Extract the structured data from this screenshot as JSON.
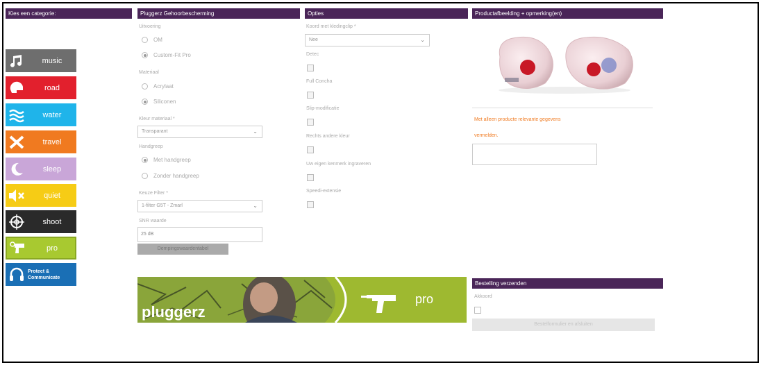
{
  "headers": {
    "category": "Kies een categorie:",
    "product": "Pluggerz Gehoorbescherming",
    "options": "Opties",
    "image": "Productafbeelding + opmerking(en)",
    "order": "Bestelling verzenden"
  },
  "categories": [
    {
      "label": "music",
      "icon": "music-note-icon",
      "color": "#6e6e6e"
    },
    {
      "label": "road",
      "icon": "helmet-icon",
      "color": "#e2202d"
    },
    {
      "label": "water",
      "icon": "wave-icon",
      "color": "#1fb4ea"
    },
    {
      "label": "travel",
      "icon": "airplane-icon",
      "color": "#f07a20"
    },
    {
      "label": "sleep",
      "icon": "moon-icon",
      "color": "#c9a6d8"
    },
    {
      "label": "quiet",
      "icon": "mute-speaker-icon",
      "color": "#f6cc15"
    },
    {
      "label": "shoot",
      "icon": "crosshair-icon",
      "color": "#2a2a2a"
    },
    {
      "label": "pro",
      "icon": "drill-icon",
      "color": "#a8c930"
    },
    {
      "label1": "Protect &",
      "label2": "Communicate",
      "icon": "headset-icon",
      "color": "#1a6fb5"
    }
  ],
  "product": {
    "uitvoering_label": "Uitvoering",
    "uitvoering_opts": [
      "OM",
      "Custom-Fit Pro"
    ],
    "materiaal_label": "Materiaal",
    "materiaal_opts": [
      "Acrylaat",
      "Siliconen"
    ],
    "kleur_label": "Kleur materiaal *",
    "kleur_value": "Transparant",
    "handgreep_label": "Handgreep",
    "handgreep_opts": [
      "Met handgreep",
      "Zonder handgreep"
    ],
    "filter_label": "Keuze Filter *",
    "filter_value": "1-filter G5T - Zmarl",
    "snr_label": "SNR waarde",
    "snr_value": "25 dB",
    "demping_button": "Dempingswaardentabel"
  },
  "options": {
    "koord_label": "Koord met kledingclip *",
    "koord_value": "Nee",
    "checks": [
      "Detec",
      "Full Concha",
      "Slip-modificatie",
      "Rechts andere kleur",
      "Uw eigen kenmerk ingraveren",
      "Speedi-extensie"
    ]
  },
  "image_panel": {
    "note_line1": "Met alleen producte relevante gegevens",
    "note_line2": "vermelden."
  },
  "order": {
    "akkoord_label": "Akkoord",
    "submit_label": "Bestelformulier en afsluiten"
  },
  "banner": {
    "brand": "pluggerz",
    "product": "pro"
  }
}
